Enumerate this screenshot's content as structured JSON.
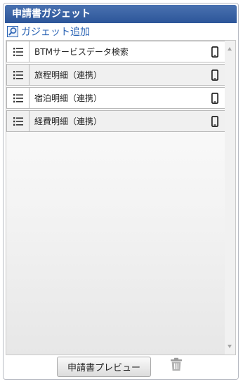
{
  "panel": {
    "title": "申請書ガジェット"
  },
  "add_link": {
    "label": "ガジェット追加",
    "icon": "search-icon"
  },
  "gadgets": [
    {
      "label": "BTMサービスデータ検索",
      "handle_icon": "drag-handle-icon",
      "device_icon": "smartphone-icon"
    },
    {
      "label": "旅程明細（連携）",
      "handle_icon": "drag-handle-icon",
      "device_icon": "smartphone-icon"
    },
    {
      "label": "宿泊明細（連携）",
      "handle_icon": "drag-handle-icon",
      "device_icon": "smartphone-icon"
    },
    {
      "label": "経費明細（連携）",
      "handle_icon": "drag-handle-icon",
      "device_icon": "smartphone-icon"
    }
  ],
  "footer": {
    "preview_label": "申請書プレビュー",
    "trash_icon": "trash-icon"
  },
  "colors": {
    "title_bg": "#2c5599",
    "link": "#2a63b4",
    "row_alt": "#f0f0f0"
  }
}
